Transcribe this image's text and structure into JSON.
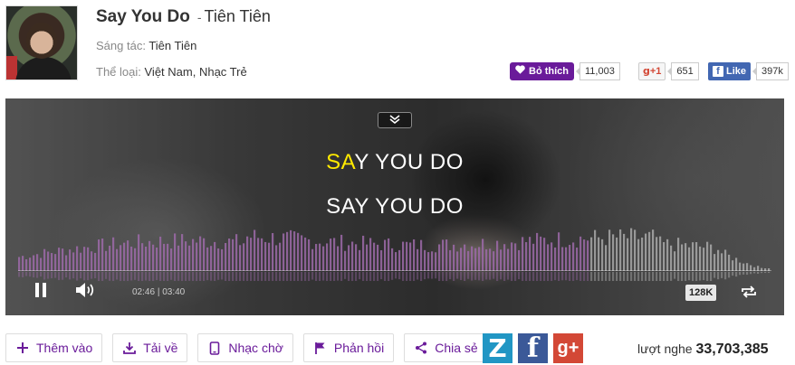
{
  "song": {
    "title": "Say You Do",
    "separator": "-",
    "artist": "Tiên Tiên",
    "composer_label": "Sáng tác:",
    "composer": "Tiên Tiên",
    "genre_label": "Thể loại:",
    "genres": "Việt Nam, Nhạc Trẻ"
  },
  "social": {
    "like_label": "Bỏ thích",
    "like_count": "11,003",
    "gplus_label": "+1",
    "gplus_count": "651",
    "fb_label": "Like",
    "fb_count": "397k"
  },
  "player": {
    "lyric_line1_highlight": "SA",
    "lyric_line1_rest": "Y YOU DO",
    "lyric_line2": "SAY YOU DO",
    "current_time": "02:46",
    "time_separator": "|",
    "duration": "03:40",
    "progress_fraction": 0.755,
    "quality": "128K",
    "icons": [
      "chevron-down-double-icon",
      "pause-icon",
      "volume-icon",
      "repeat-icon"
    ],
    "colors": {
      "played": "#9c6aa8",
      "unplayed": "#bdbdbd",
      "lyric_highlight": "#ffea00"
    }
  },
  "actions": [
    {
      "label": "Thêm vào",
      "icon": "plus-icon"
    },
    {
      "label": "Tải về",
      "icon": "download-icon"
    },
    {
      "label": "Nhạc chờ",
      "icon": "phone-icon"
    },
    {
      "label": "Phản hồi",
      "icon": "flag-icon"
    },
    {
      "label": "Chia sẻ",
      "icon": "share-icon"
    }
  ],
  "share": {
    "zing": "Z",
    "facebook": "f",
    "gplus": "g+"
  },
  "plays": {
    "label": "lượt nghe",
    "count": "33,703,385"
  },
  "colors": {
    "brand_purple": "#6a1b9a",
    "facebook_blue": "#3b5998",
    "gplus_red": "#d34836",
    "zing_blue": "#2196c4"
  }
}
